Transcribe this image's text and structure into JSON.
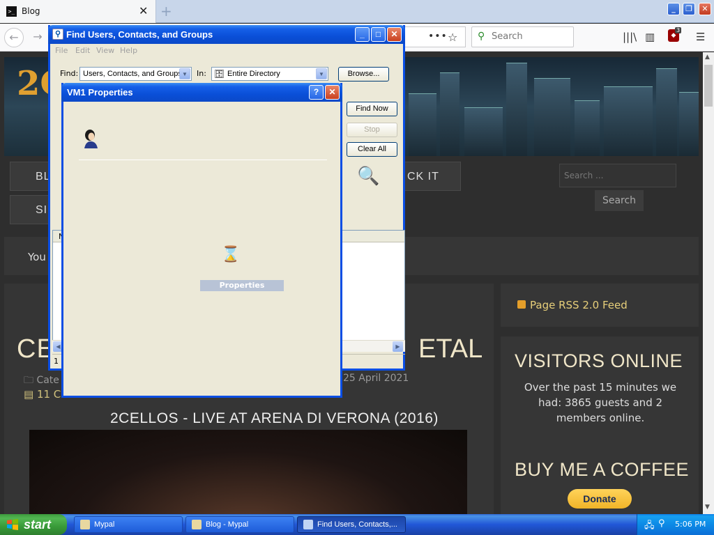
{
  "browser": {
    "tab_title": "Blog",
    "tab_favicon": ">_",
    "new_tab": "+",
    "close_tab": "✕",
    "search_placeholder": "Search",
    "ublock_count": "3"
  },
  "webpage": {
    "logo": "2C",
    "nav": {
      "blog": "BL",
      "sign": "SI",
      "rock": "CK IT"
    },
    "site_search_placeholder": "Search ...",
    "site_search_button": "Search",
    "you_text": "You",
    "article": {
      "title_left": "CEL",
      "title_right": "ETAL",
      "category": "Cate",
      "date": "25 April 2021",
      "comments": "11 C",
      "stars": "★★★★★"
    },
    "video_title": "2CELLOS - LIVE AT ARENA DI VERONA (2016)",
    "sidebar": {
      "rss": "Page RSS 2.0 Feed",
      "visitors_heading": "VISITORS ONLINE",
      "visitors_body": "Over the past 15 minutes we had: 3865 guests and 2 members online.",
      "coffee_heading": "BUY ME A COFFEE",
      "donate": "Donate"
    }
  },
  "find_dialog": {
    "title": "Find Users, Contacts, and Groups",
    "menu": [
      "File",
      "Edit",
      "View",
      "Help"
    ],
    "find_label": "Find:",
    "find_value": "Users, Contacts, and Groups",
    "in_label": "In:",
    "in_value": "Entire Directory",
    "browse": "Browse...",
    "find_now": "Find Now",
    "stop": "Stop",
    "clear_all": "Clear All",
    "results_header": "N",
    "status": "1 it"
  },
  "properties_dialog": {
    "title": "VM1 Properties",
    "help": "?",
    "close": "✕",
    "progress_label": "Properties"
  },
  "taskbar": {
    "start": "start",
    "tasks": [
      "Mypal",
      "Blog - Mypal",
      "Find Users, Contacts,..."
    ],
    "clock": "5:06 PM"
  }
}
